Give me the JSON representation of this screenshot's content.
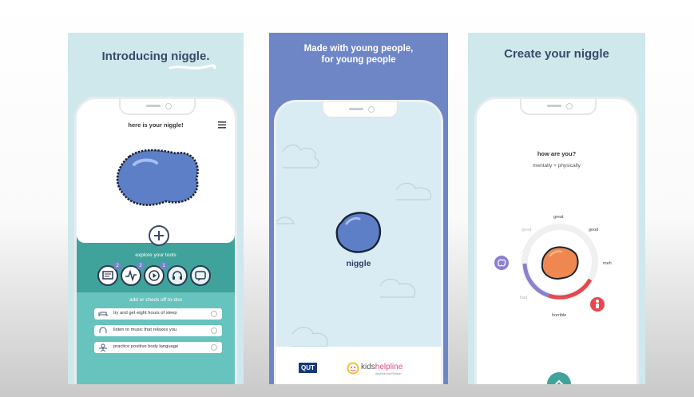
{
  "panels": [
    {
      "title": "Introducing niggle.",
      "screen": {
        "header": "here is your niggle!",
        "menu_icon": "hamburger-menu-icon",
        "add_icon": "plus-icon",
        "tools_label": "explore your tools",
        "tools": [
          {
            "icon": "chat-icon",
            "badge": "2"
          },
          {
            "icon": "activity-icon",
            "badge": "2"
          },
          {
            "icon": "play-icon",
            "badge": "1"
          },
          {
            "icon": "headphones-icon",
            "badge": ""
          },
          {
            "icon": "message-icon",
            "badge": ""
          }
        ],
        "todo_heading": "add or check off to-dos",
        "todos": [
          {
            "icon": "bed-icon",
            "text": "try and get eight hours of sleep"
          },
          {
            "icon": "headphones-icon",
            "text": "listen to music that relaxes you"
          },
          {
            "icon": "person-icon",
            "text": "practice positive body language"
          }
        ]
      }
    },
    {
      "title_line1": "Made with young people,",
      "title_line2": "for young people",
      "screen": {
        "niggle_label": "niggle",
        "logos": {
          "qut": "QUT",
          "kids": "kids",
          "helpline": "helpline",
          "tagline": "Anytime Any Reason"
        }
      }
    },
    {
      "title": "Create your niggle",
      "screen": {
        "question": "how are you?",
        "subtitle": "mentally + physically",
        "mood_labels": {
          "great": "great",
          "good_top": "good",
          "good_left": "good",
          "meh": "meh",
          "bad": "bad",
          "horrible": "horrible"
        },
        "brain_icon": "brain-icon",
        "body_icon": "person-icon"
      }
    }
  ],
  "colors": {
    "teal_light": "#cfe8ec",
    "teal": "#3fa39b",
    "blue_panel": "#6e86c6",
    "niggle_blue": "#5d7fc8",
    "niggle_orange": "#ee8850",
    "purple": "#8d7fd0",
    "red": "#e6484e"
  }
}
